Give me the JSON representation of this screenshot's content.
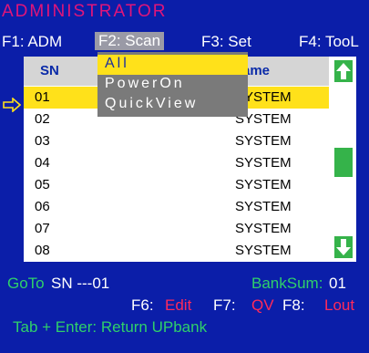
{
  "title": "ADMINISTRATOR",
  "menu": {
    "f1": "F1: ADM",
    "f2": "F2: Scan",
    "f3": "F3: Set",
    "f4": "F4: TooL"
  },
  "dropdown": {
    "items": [
      "All",
      "PowerOn",
      "QuickView"
    ],
    "selected": "All"
  },
  "table": {
    "headers": [
      "SN",
      "ame"
    ],
    "rows": [
      {
        "sn": "01",
        "name": "SYSTEM"
      },
      {
        "sn": "02",
        "name": "SYSTEM"
      },
      {
        "sn": "03",
        "name": "SYSTEM"
      },
      {
        "sn": "04",
        "name": "SYSTEM"
      },
      {
        "sn": "05",
        "name": "SYSTEM"
      },
      {
        "sn": "06",
        "name": "SYSTEM"
      },
      {
        "sn": "07",
        "name": "SYSTEM"
      },
      {
        "sn": "08",
        "name": "SYSTEM"
      }
    ],
    "selected_row": "01"
  },
  "footer": {
    "goto_label": "GoTo",
    "goto_value": "SN ---01",
    "banksum_label": "BankSum:",
    "banksum_value": "01",
    "f6": "F6:",
    "f6_action": "Edit",
    "f7": "F7:",
    "f7_action": "QV",
    "f8": "F8:",
    "f8_action": "Lout",
    "hint": "Tab + Enter: Return UPbank"
  },
  "colors": {
    "background": "#0b1ea9",
    "title": "#e0157a",
    "selection": "#ffe11a",
    "accent_green": "#35b34a",
    "action_red": "#ff2a5a"
  },
  "icons": {
    "row_pointer": "arrow-right-icon",
    "scroll_up": "arrow-up-icon",
    "scroll_down": "arrow-down-icon"
  }
}
